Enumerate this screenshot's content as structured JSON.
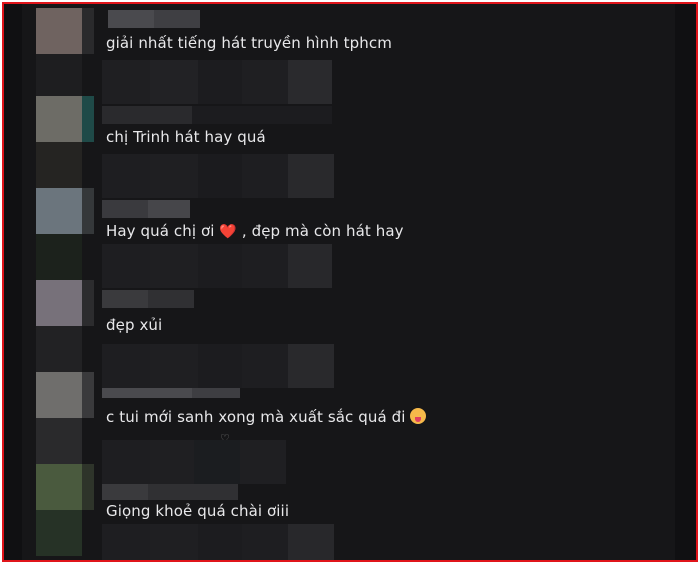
{
  "comments": [
    {
      "text": "giải nhất tiếng hát truyền hình tphcm"
    },
    {
      "text": "chị Trinh hát hay quá"
    },
    {
      "text_before": "Hay quá chị ơi ",
      "heart": "❤️",
      "text_after": " , đẹp mà còn hát hay"
    },
    {
      "text": "đẹp xủi"
    },
    {
      "text_before": "c tui mới sanh xong mà xuất sắc quá đi ",
      "emoji": "😝"
    },
    {
      "text": "Giọng khoẻ quá chài ơiii"
    }
  ],
  "colors": {
    "frame_border": "#e0151b",
    "background": "#161618",
    "text": "#e8e8ea"
  },
  "icons": {
    "heart": "heart-icon",
    "face": "face-with-tongue-icon"
  }
}
